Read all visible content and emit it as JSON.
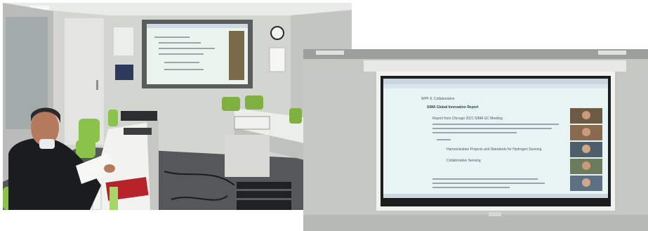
{
  "left_photo": {
    "screen_text": {
      "heading": "",
      "lines": []
    }
  },
  "right_photo": {
    "screen_text": {
      "line1": "WPF 6. Collaboration",
      "line2": "SIMA Global Innovation Report",
      "line3": "Report from Chicago 2021 SIMA GC Meeting",
      "line4": "Harmonization Projects and Standards for Hydrogen Sensing",
      "line5": "Collaborative Sensing"
    }
  }
}
